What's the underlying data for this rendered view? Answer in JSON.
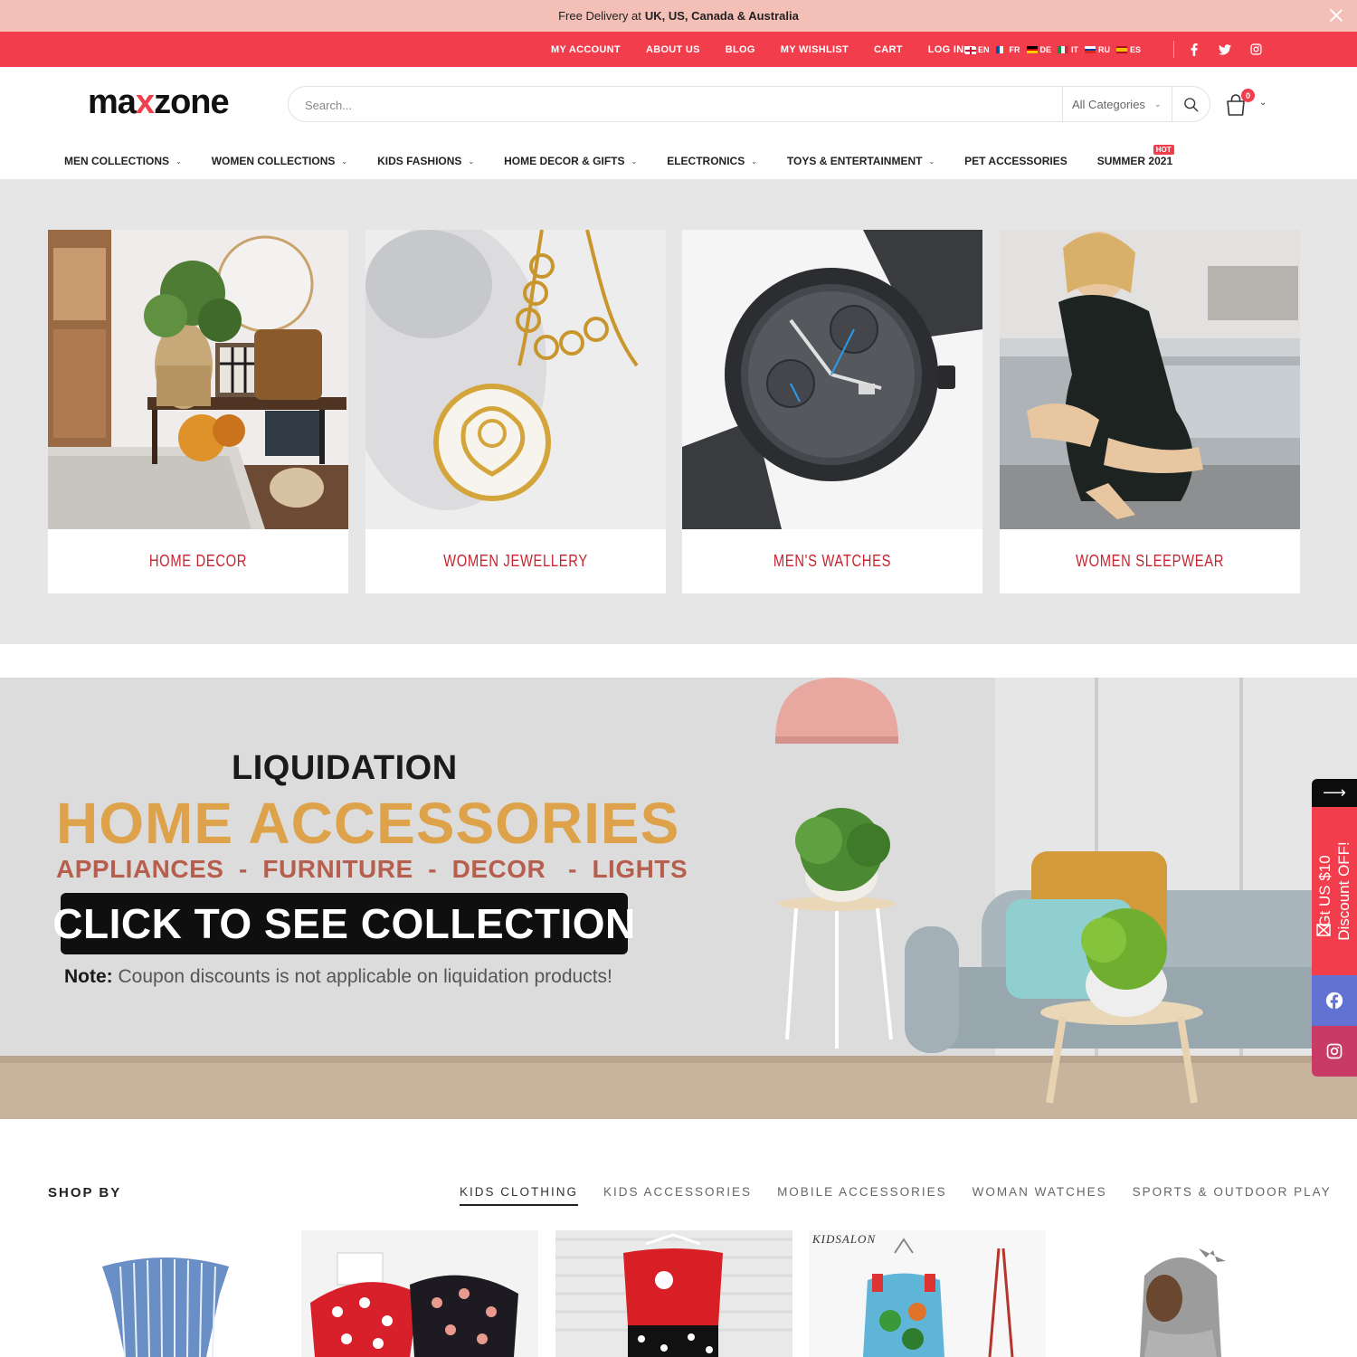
{
  "promo": {
    "text": "Free Delivery at",
    "bold": "UK, US, Canada & Australia"
  },
  "topnav": {
    "links": [
      "MY ACCOUNT",
      "ABOUT US",
      "BLOG",
      "MY WISHLIST",
      "CART",
      "LOG IN"
    ],
    "languages": [
      "EN",
      "FR",
      "DE",
      "IT",
      "RU",
      "ES"
    ],
    "social_icons": [
      "facebook-icon",
      "twitter-icon",
      "instagram-icon"
    ]
  },
  "header": {
    "logo_left": "ma",
    "logo_x": "x",
    "logo_right": "zone",
    "search_placeholder": "Search...",
    "category_select": "All Categories",
    "cart_count": "0"
  },
  "mainnav": {
    "items": [
      "MEN COLLECTIONS",
      "WOMEN COLLECTIONS",
      "KIDS FASHIONS",
      "HOME DECOR & GIFTS",
      "ELECTRONICS",
      "TOYS & ENTERTAINMENT",
      "PET ACCESSORIES",
      "SUMMER 2021"
    ],
    "hot_badge": "HOT"
  },
  "categories": [
    "HOME DECOR",
    "WOMEN JEWELLERY",
    "MEN'S WATCHES",
    "WOMEN SLEEPWEAR"
  ],
  "banner": {
    "title": "LIQUIDATION",
    "headline": "HOME ACCESSORIES",
    "subline": "APPLIANCES  -  FURNITURE  -  DECOR   -  LIGHTS",
    "cta": "CLICK TO SEE COLLECTION",
    "note_label": "Note:",
    "note_text": " Coupon discounts is not applicable on liquidation products!"
  },
  "float": {
    "coupon_line1": "Gt US $10",
    "coupon_line2": "Discount OFF!"
  },
  "shopby": {
    "heading": "SHOP BY",
    "tabs": [
      "KIDS CLOTHING",
      "KIDS ACCESSORIES",
      "MOBILE ACCESSORIES",
      "WOMAN WATCHES",
      "SPORTS & OUTDOOR PLAY"
    ],
    "active_tab": "KIDS CLOTHING",
    "brand_text": "KIDSALON"
  },
  "colors": {
    "accent": "#f23d4c",
    "promo_bg": "#f4bfb6",
    "category_label": "#c8242f",
    "banner_headline": "#dda24a"
  }
}
